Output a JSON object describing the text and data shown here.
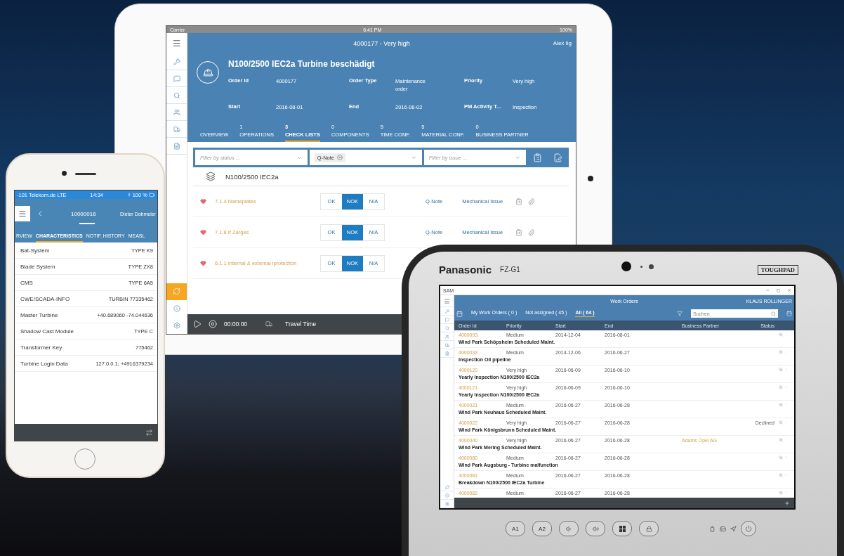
{
  "ipad": {
    "status_bar": {
      "carrier": "Carrier",
      "time": "6:41 PM",
      "battery": "100%"
    },
    "header": {
      "subtitle": "4000177 - Very high",
      "user": "Alex Ilg",
      "title": "N100/2500 IEC2a Turbine beschädigt",
      "fields": [
        {
          "label": "Order Id",
          "value": "4000177"
        },
        {
          "label": "Order Type",
          "value": "Maintenance order"
        },
        {
          "label": "Priority",
          "value": "Very high"
        },
        {
          "label": "Start",
          "value": "2016-08-01"
        },
        {
          "label": "End",
          "value": "2016-08-02"
        },
        {
          "label": "PM Activity T...",
          "value": "Inspection"
        }
      ]
    },
    "tabs": [
      {
        "label": "OVERVIEW",
        "selected": false
      },
      {
        "count": "1",
        "label": "OPERATIONS",
        "selected": false
      },
      {
        "count": "3",
        "label": "CHECK LISTS",
        "selected": true
      },
      {
        "count": "0",
        "label": "COMPONENTS",
        "selected": false
      },
      {
        "count": "5",
        "label": "TIME CONF.",
        "selected": false
      },
      {
        "count": "5",
        "label": "MATERIAL CONF.",
        "selected": false
      },
      {
        "count": "0",
        "label": "BUSINESS PARTNER",
        "selected": false
      }
    ],
    "filters": [
      {
        "kind": "select",
        "placeholder": "Filter by status ..."
      },
      {
        "kind": "chip",
        "chip": "Q-Note"
      },
      {
        "kind": "select",
        "placeholder": "Filter by issue ..."
      }
    ],
    "group": "N100/2500 IEC2a",
    "checklist": [
      {
        "label": "7.1.4 Nameplates",
        "options": [
          {
            "label": "OK",
            "selected": false
          },
          {
            "label": "NOK",
            "selected": true
          },
          {
            "label": "N/A",
            "selected": false
          }
        ],
        "links": [
          "Q-Note",
          "Mechanical Issue"
        ]
      },
      {
        "label": "7.1.8 If Zarges",
        "options": [
          {
            "label": "OK",
            "selected": false
          },
          {
            "label": "NOK",
            "selected": true
          },
          {
            "label": "N/A",
            "selected": false
          }
        ],
        "links": [
          "Q-Note",
          "Mechanical Issue"
        ]
      },
      {
        "label": "6.1.1 Internal & external lprotection",
        "options": [
          {
            "label": "OK",
            "selected": false
          },
          {
            "label": "NOK",
            "selected": true
          },
          {
            "label": "N/A",
            "selected": false
          }
        ]
      }
    ],
    "footer": {
      "timer": "00:00:00",
      "label": "Travel Time"
    }
  },
  "iphone": {
    "status_bar": {
      "carrier": "-101 Telekom.de  LTE",
      "time": "14:34",
      "battery": "100 %"
    },
    "header": {
      "id": "10000016",
      "user": "Dieter Dobmeier"
    },
    "tabs": [
      {
        "label": "RVIEW",
        "selected": false
      },
      {
        "label": "CHARACTERISTICS",
        "selected": true
      },
      {
        "label": "NOTIF. HISTORY",
        "selected": false
      },
      {
        "label": "MEASL",
        "selected": false
      }
    ],
    "characteristics": [
      {
        "label": "Bat-System",
        "value": "TYPE K9"
      },
      {
        "label": "Blade System",
        "value": "TYPE ZX8"
      },
      {
        "label": "CMS",
        "value": "TYPE 6A5"
      },
      {
        "label": "CWE/SCADA-INFO",
        "value": "TURBIN 77335462"
      },
      {
        "label": "Master Turbine",
        "value": "+40.689060 -74.044636"
      },
      {
        "label": "Shadow Cast Module",
        "value": "TYPE C"
      },
      {
        "label": "Transformer Key",
        "value": "775462"
      },
      {
        "label": "Turbine Login Data",
        "value": "127.0.0.1; +4916379234"
      }
    ]
  },
  "toughpad": {
    "brand": "Panasonic",
    "model": "FZ-G1",
    "badge": "TOUGHPAD",
    "app_title": "SAM",
    "header": {
      "title": "Work Orders",
      "user": "KLAUS ROLLINGER"
    },
    "tabs": [
      {
        "label": "My Work Orders ( 0 )",
        "selected": false
      },
      {
        "label": "Not assigned ( 45 )",
        "selected": false
      },
      {
        "label": "All ( 64 )",
        "selected": true
      }
    ],
    "search": {
      "placeholder": "Suchen"
    },
    "columns": [
      "Order Id",
      "Priority",
      "Start",
      "End",
      "Business Partner",
      "Status"
    ],
    "rows": [
      {
        "id": "4000093",
        "priority": "Medium",
        "start": "2014-12-04",
        "end": "2016-08-01",
        "title": "Wind Park Schöpsheim Scheduled Maint."
      },
      {
        "id": "4000033",
        "priority": "Medium",
        "start": "2014-12-06",
        "end": "2016-06-27",
        "title": "Inspection Oil pipeline"
      },
      {
        "id": "4000120",
        "priority": "Very high",
        "start": "2016-06-09",
        "end": "2016-06-10",
        "title": "Yearly Inspection N100/2500 IEC2a"
      },
      {
        "id": "4000121",
        "priority": "Very high",
        "start": "2016-06-09",
        "end": "2016-06-10",
        "title": "Yearly Inspection N100/2500 IEC2a"
      },
      {
        "id": "4000021",
        "priority": "Medium",
        "start": "2016-06-27",
        "end": "2016-06-28",
        "title": "Wind Park Neuhaus Scheduled Maint."
      },
      {
        "id": "4000022",
        "priority": "Very high",
        "start": "2016-06-27",
        "end": "2016-06-28",
        "status": "Declined",
        "title": "Wind Park Königsbrunn Scheduled Maint."
      },
      {
        "id": "4000040",
        "priority": "Very high",
        "start": "2016-06-27",
        "end": "2016-06-28",
        "partner": "Adams Opel AG",
        "title": "Wind Park Mering Scheduled Maint."
      },
      {
        "id": "4000080",
        "priority": "Medium",
        "start": "2016-06-27",
        "end": "2016-06-28",
        "title": "Wind Park Augsburg - Turbine malfunction"
      },
      {
        "id": "4000081",
        "priority": "Medium",
        "start": "2016-06-27",
        "end": "2016-06-28",
        "title": "Breakdown N100/2500 IEC2a Turbine"
      },
      {
        "id": "4000082",
        "priority": "Medium",
        "start": "2016-06-27",
        "end": "2016-06-28"
      }
    ],
    "keys": [
      "A1",
      "A2"
    ]
  }
}
